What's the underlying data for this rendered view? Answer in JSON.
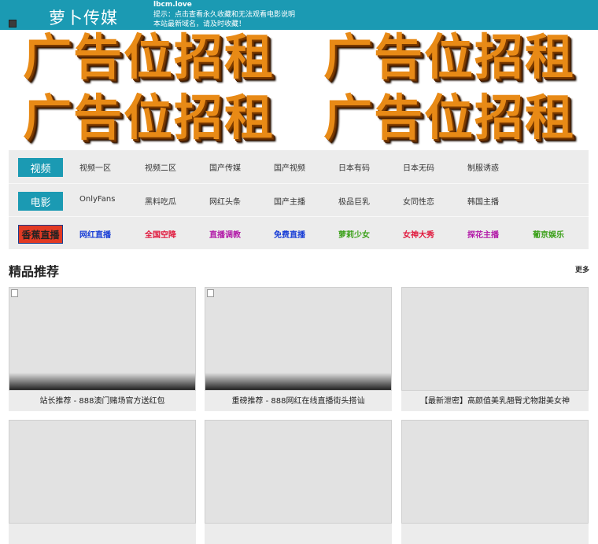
{
  "header": {
    "logo": "萝卜传媒",
    "domain": "lbcm.love",
    "tip_line1": "提示：点击查看永久收藏和无法观看电影说明",
    "tip_line2": "本站最新域名，请及时收藏！"
  },
  "banners": [
    "广告位招租",
    "广告位招租",
    "广告位招租",
    "广告位招租"
  ],
  "nav": {
    "rows": [
      {
        "category": "视频",
        "links": [
          "视频一区",
          "视频二区",
          "国产传媒",
          "国产视频",
          "日本有码",
          "日本无码",
          "制服诱惑"
        ]
      },
      {
        "category": "电影",
        "links": [
          "OnlyFans",
          "黑料吃瓜",
          "网红头条",
          "国产主播",
          "极品巨乳",
          "女同性恋",
          "韩国主播"
        ]
      },
      {
        "category": "香蕉直播",
        "links": [
          "网红直播",
          "全国空降",
          "直播调教",
          "免费直播",
          "萝莉少女",
          "女神大秀",
          "探花主播",
          "葡京娱乐"
        ]
      }
    ],
    "live_link_colors": [
      "#1a3fd6",
      "#e0183c",
      "#b21aa8",
      "#1a3fd6",
      "#3aa018",
      "#e0183c",
      "#b21aa8",
      "#3aa018"
    ]
  },
  "section": {
    "title": "精品推荐",
    "more": "更多"
  },
  "cards": [
    {
      "caption": "站长推荐 - 888澳门赌场官方送红包"
    },
    {
      "caption": "重磅推荐 - 888网红在线直播街头搭讪"
    },
    {
      "caption": "【最新泄密】高颜值美乳翘臀尤物甜美女神"
    },
    {
      "caption": ""
    },
    {
      "caption": ""
    },
    {
      "caption": ""
    }
  ]
}
